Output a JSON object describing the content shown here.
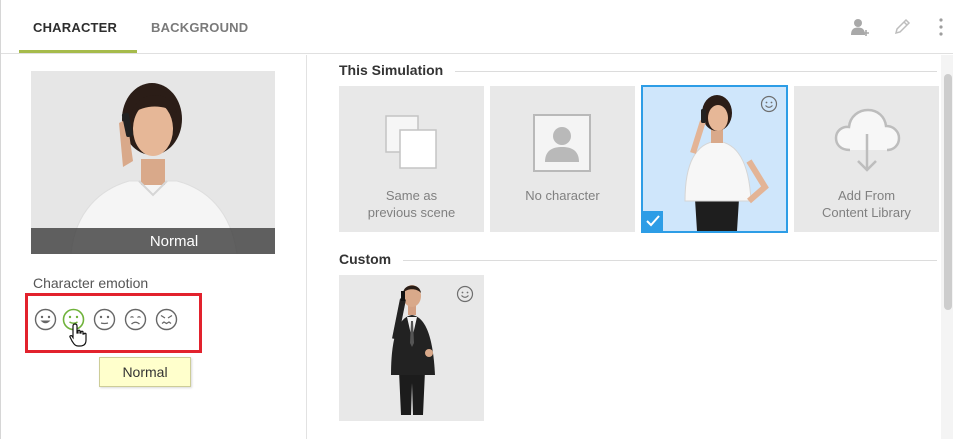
{
  "tabs": {
    "character": "CHARACTER",
    "background": "BACKGROUND"
  },
  "toolbar": {
    "icons": [
      "add-character-icon",
      "edit-icon",
      "more-vertical-icon"
    ]
  },
  "preview": {
    "caption": "Normal"
  },
  "emotion": {
    "label": "Character emotion",
    "options": [
      "smile-face-icon",
      "normal-face-icon",
      "neutral-face-icon",
      "sad-face-icon",
      "angry-face-icon"
    ],
    "tooltip": "Normal"
  },
  "sections": {
    "this_simulation": {
      "title": "This Simulation",
      "cards": [
        {
          "label_line1": "Same as",
          "label_line2": "previous scene"
        },
        {
          "label": "No character"
        },
        {
          "label": ""
        },
        {
          "label_line1": "Add From",
          "label_line2": "Content Library"
        }
      ]
    },
    "custom": {
      "title": "Custom"
    }
  },
  "colors": {
    "accent_underline": "#a6bb4b",
    "selection_blue": "#2d9de6",
    "highlight_red": "#e2222d",
    "tooltip_bg": "#ffffcc"
  }
}
